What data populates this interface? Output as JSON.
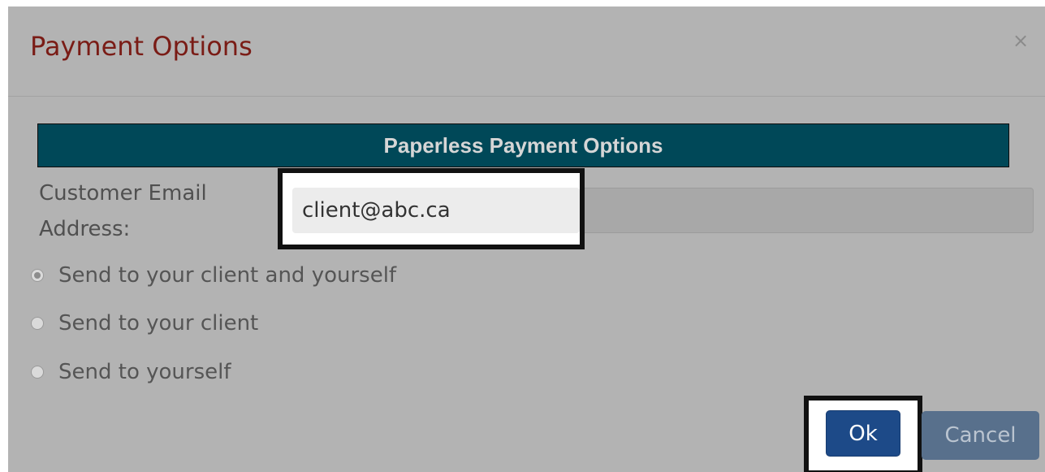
{
  "dialog": {
    "title": "Payment Options",
    "close_label": "×"
  },
  "section": {
    "title": "Paperless Payment Options"
  },
  "email": {
    "label": "Customer Email Address:",
    "value": "client@abc.ca"
  },
  "recipient_options": [
    {
      "label": "Send to your client and yourself",
      "selected": true
    },
    {
      "label": "Send to your client",
      "selected": false
    },
    {
      "label": "Send to yourself",
      "selected": false
    }
  ],
  "buttons": {
    "ok_label": "Ok",
    "cancel_label": "Cancel"
  },
  "colors": {
    "title": "#7a1c16",
    "section_header_bg": "#004858",
    "ok_button": "#1d4a88",
    "cancel_button": "#58708c",
    "highlight_border": "#111111"
  }
}
